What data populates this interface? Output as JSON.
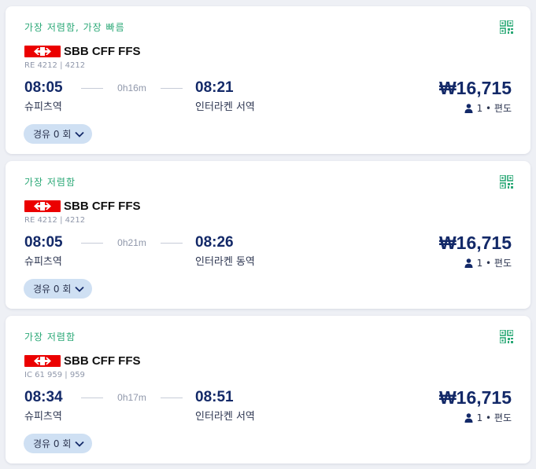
{
  "results": [
    {
      "tags": "가장 저렴함, 가장 빠름",
      "operator": "SBB CFF FFS",
      "train_no": "RE 4212 | 4212",
      "departure_time": "08:05",
      "duration": "0h16m",
      "arrival_time": "08:21",
      "departure_station": "슈피츠역",
      "arrival_station": "인터라켄 서역",
      "price": "₩16,715",
      "passengers": "1 • 편도",
      "stops": "경유 0 회"
    },
    {
      "tags": "가장 저렴함",
      "operator": "SBB CFF FFS",
      "train_no": "RE 4212 | 4212",
      "departure_time": "08:05",
      "duration": "0h21m",
      "arrival_time": "08:26",
      "departure_station": "슈피츠역",
      "arrival_station": "인터라켄 동역",
      "price": "₩16,715",
      "passengers": "1 • 편도",
      "stops": "경유 0 회"
    },
    {
      "tags": "가장 저렴함",
      "operator": "SBB CFF FFS",
      "train_no": "IC 61 959 | 959",
      "departure_time": "08:34",
      "duration": "0h17m",
      "arrival_time": "08:51",
      "departure_station": "슈피츠역",
      "arrival_station": "인터라켄 서역",
      "price": "₩16,715",
      "passengers": "1 • 편도",
      "stops": "경유 0 회"
    }
  ],
  "icons": {
    "qr": "qr-code-icon",
    "operator_logo": "sbb-logo-icon",
    "passenger": "person-icon",
    "expand": "chevron-down-icon"
  },
  "colors": {
    "accent_green": "#2aa876",
    "navy": "#132968",
    "sbb_red": "#eb0000",
    "pill_bg": "#cfe0f3"
  }
}
